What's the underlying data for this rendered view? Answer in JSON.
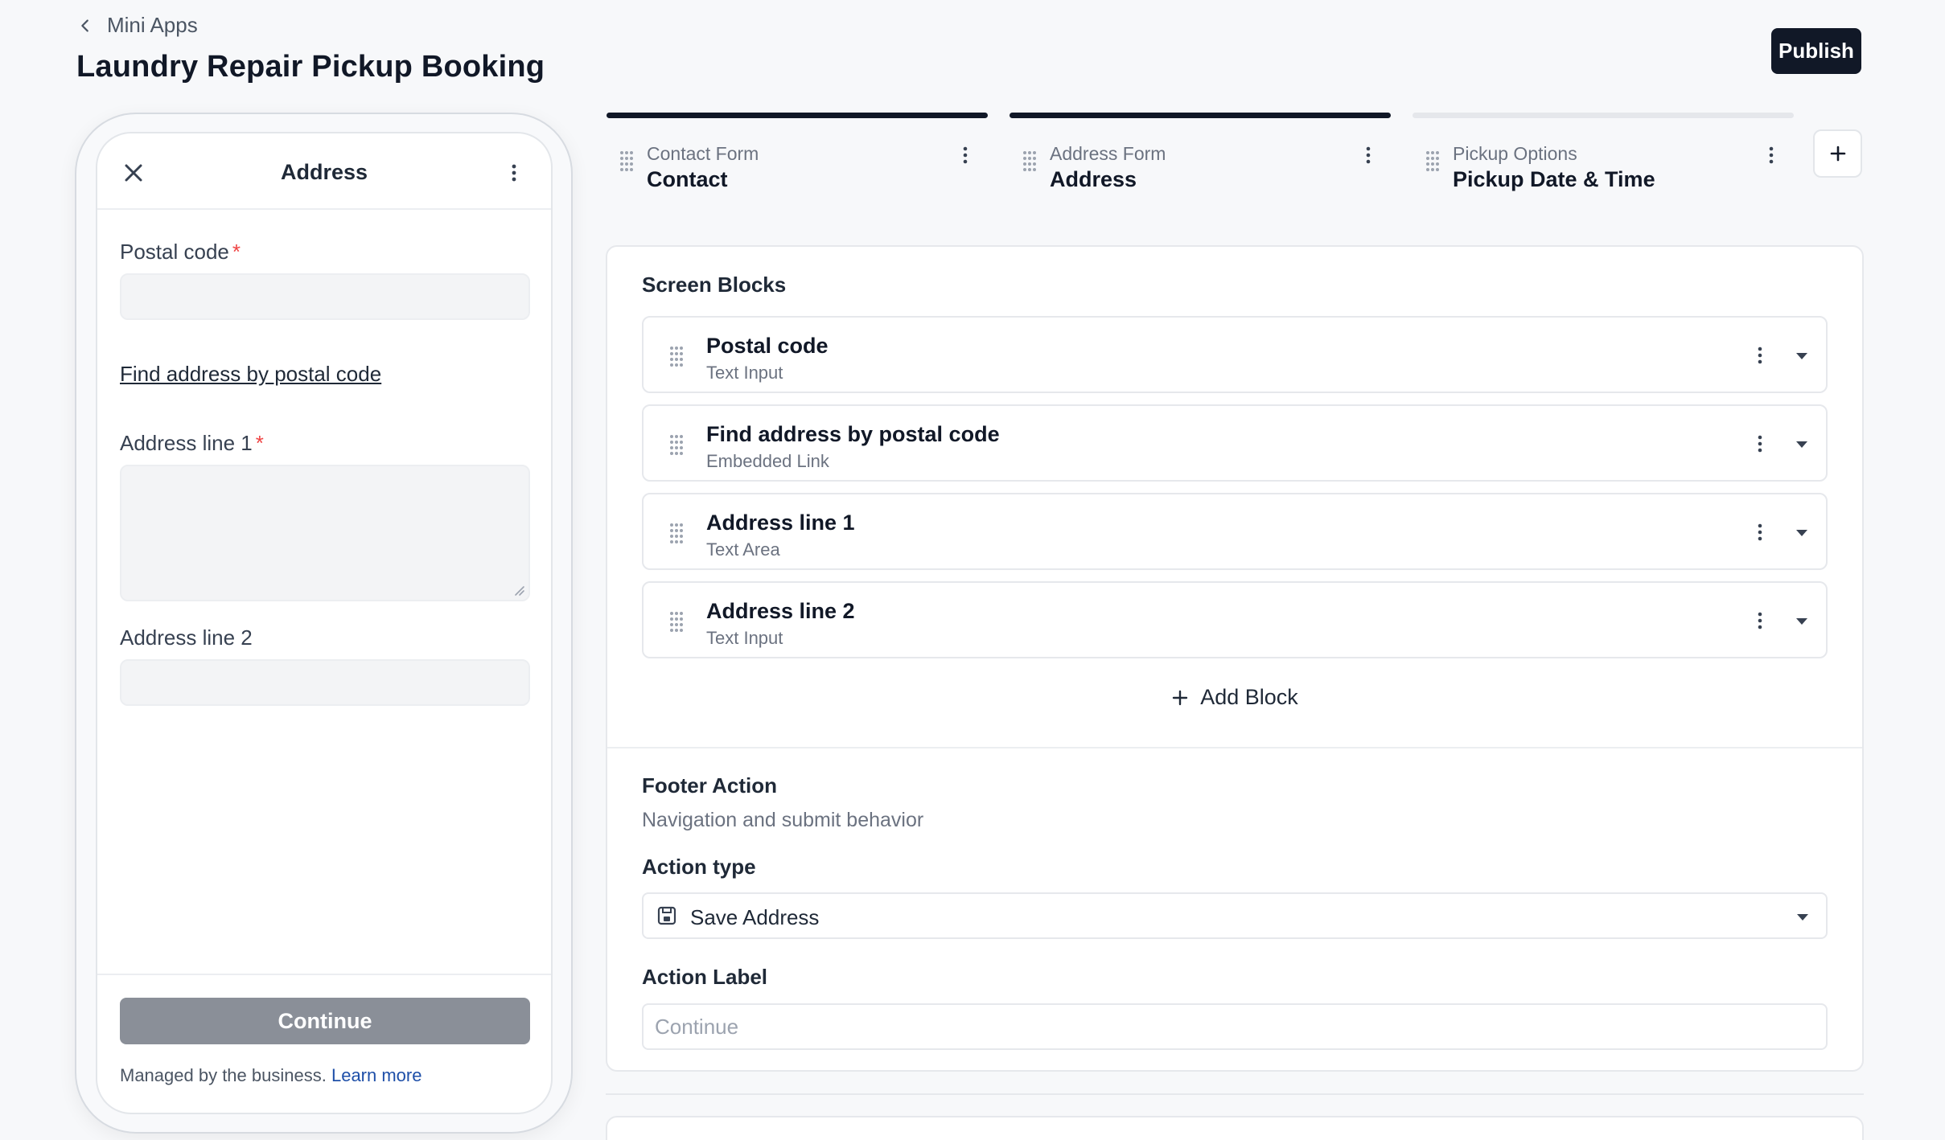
{
  "header": {
    "back_label": "Mini Apps",
    "title": "Laundry Repair Pickup Booking",
    "publish_label": "Publish"
  },
  "preview": {
    "screen_title": "Address",
    "fields": [
      {
        "label": "Postal code",
        "required": "*"
      },
      {
        "label": "Address line 1",
        "required": "*"
      },
      {
        "label": "Address line 2"
      }
    ],
    "link_text": "Find address by postal code",
    "continue_label": "Continue",
    "managed_text": "Managed by the business.",
    "learn_more": "Learn more"
  },
  "tabs": [
    {
      "type": "Contact Form",
      "title": "Contact",
      "active": true
    },
    {
      "type": "Address Form",
      "title": "Address",
      "active": true
    },
    {
      "type": "Pickup Options",
      "title": "Pickup Date & Time",
      "active": false
    }
  ],
  "editor": {
    "blocks_title": "Screen Blocks",
    "blocks": [
      {
        "title": "Postal code",
        "type": "Text Input"
      },
      {
        "title": "Find address by postal code",
        "type": "Embedded Link"
      },
      {
        "title": "Address line 1",
        "type": "Text Area"
      },
      {
        "title": "Address line 2",
        "type": "Text Input"
      }
    ],
    "add_block_label": "Add Block",
    "footer_title": "Footer Action",
    "footer_subtitle": "Navigation and submit behavior",
    "action_type_label": "Action type",
    "action_type_value": "Save Address",
    "action_type_icon": "save-icon",
    "action_label_title": "Action Label",
    "action_label_placeholder": "Continue"
  },
  "colors": {
    "primary": "#111827",
    "required": "#ef4444",
    "link": "#1e4fa8",
    "disabled_button": "#8a8f98"
  }
}
